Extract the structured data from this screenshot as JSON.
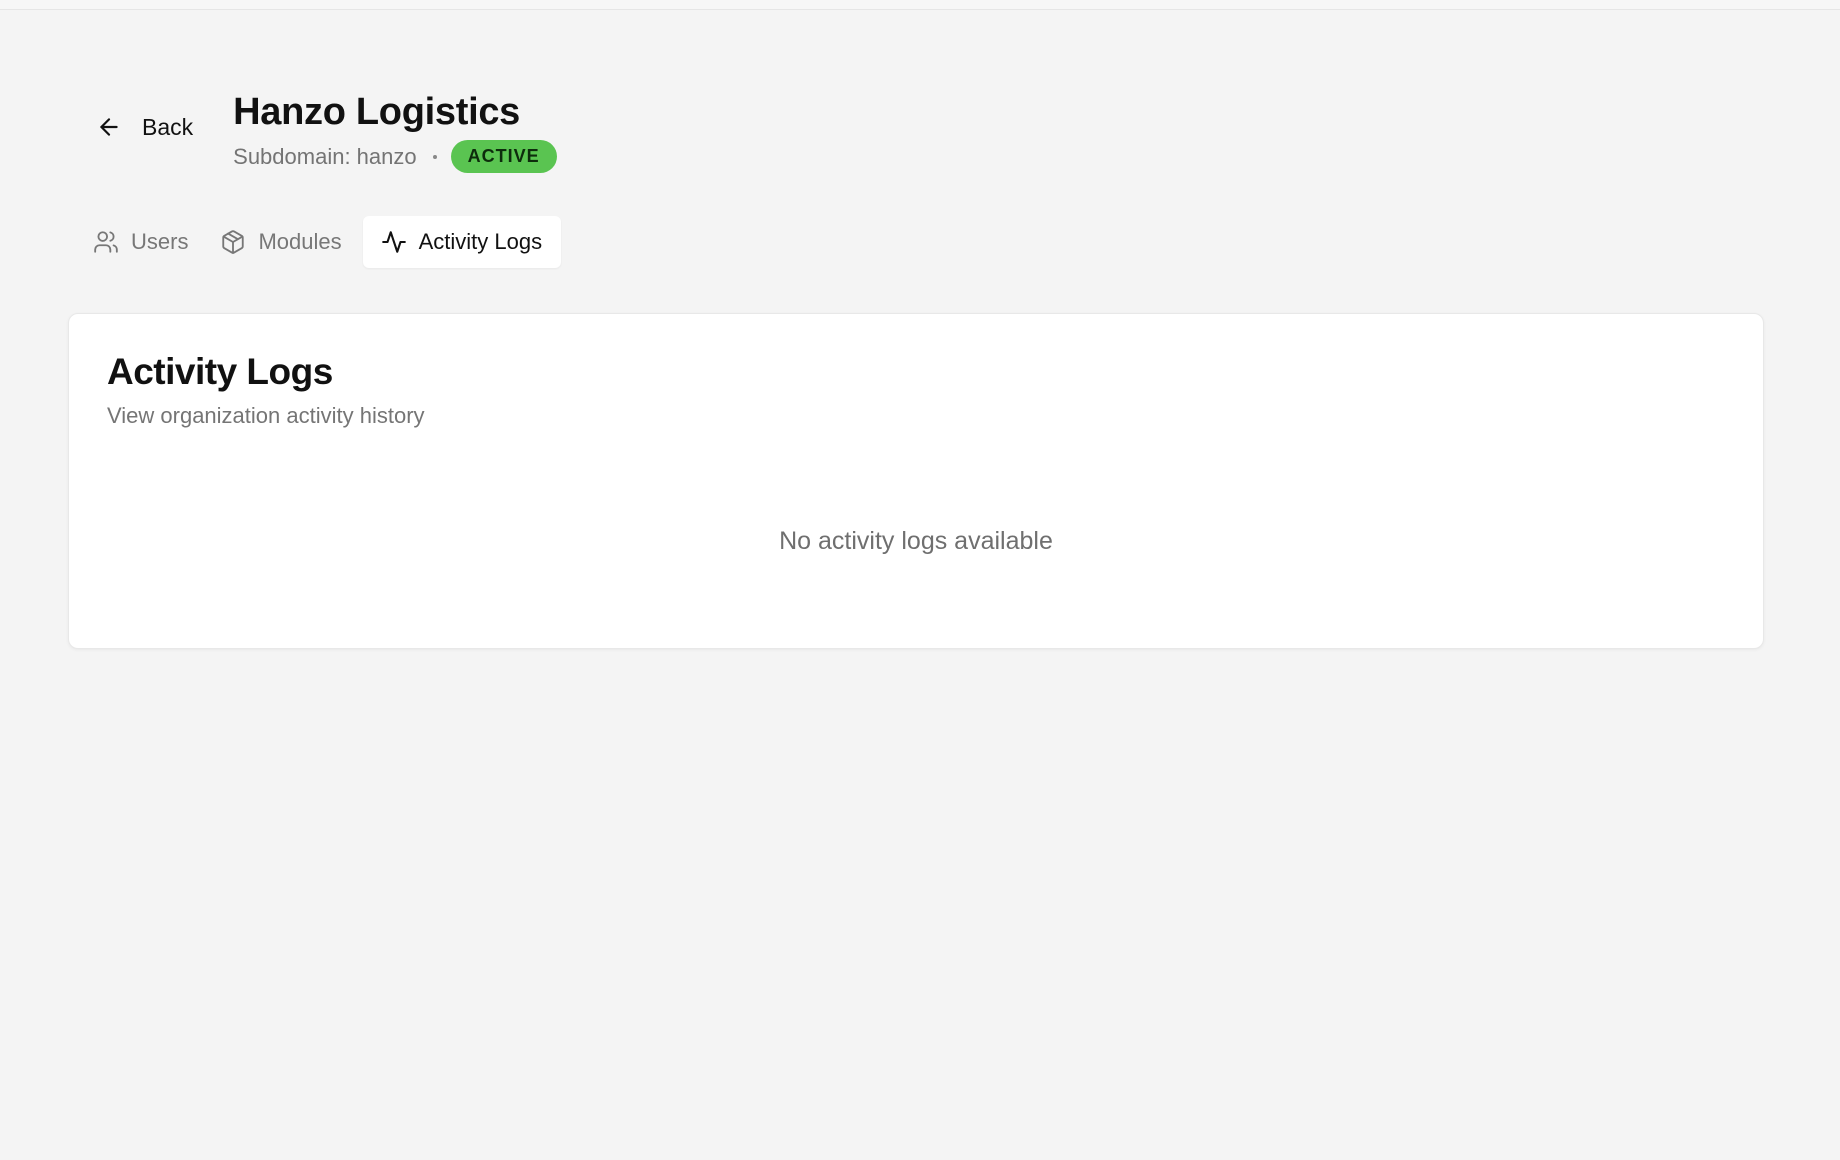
{
  "header": {
    "back_label": "Back",
    "title": "Hanzo Logistics",
    "subdomain_text": "Subdomain: hanzo",
    "status": "ACTIVE"
  },
  "tabs": [
    {
      "label": "Users",
      "icon": "users-icon",
      "active": false
    },
    {
      "label": "Modules",
      "icon": "package-icon",
      "active": false
    },
    {
      "label": "Activity Logs",
      "icon": "activity-icon",
      "active": true
    }
  ],
  "card": {
    "title": "Activity Logs",
    "subtitle": "View organization activity history",
    "empty_message": "No activity logs available"
  },
  "colors": {
    "background": "#f4f4f4",
    "status_badge": "#5ac451",
    "card_background": "#ffffff"
  }
}
